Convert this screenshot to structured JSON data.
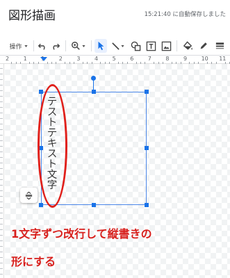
{
  "app": {
    "title": "図形描画",
    "save_status": "15:21:40 に自動保存しました"
  },
  "toolbar": {
    "actions_label": "操作"
  },
  "ruler": {
    "numbers": [
      "2",
      "1",
      "1",
      "2",
      "3",
      "4",
      "5",
      "6",
      "7",
      "8",
      "9",
      "10",
      "11"
    ]
  },
  "shape": {
    "text_chars": [
      "テ",
      "ス",
      "ト",
      "テ",
      "キ",
      "ス",
      "ト",
      "文",
      "字"
    ]
  },
  "annotation": {
    "line1": "1文字ずつ改行して縦書きの",
    "line2": "形にする"
  },
  "colors": {
    "accent": "#1a73e8",
    "annotation": "#e0201b"
  }
}
